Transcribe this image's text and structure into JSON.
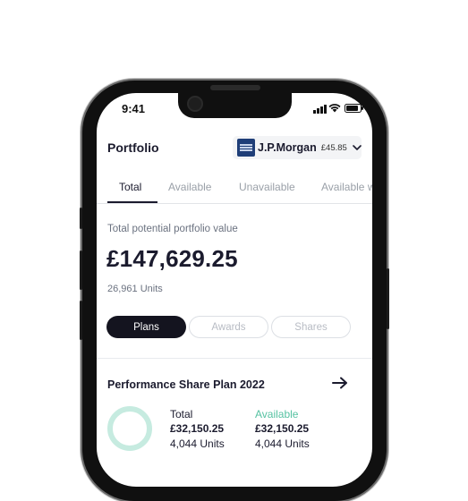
{
  "status_bar": {
    "time": "9:41"
  },
  "header": {
    "title": "Portfolio",
    "account": {
      "company": "J.P.Morgan",
      "price": "£45.85"
    }
  },
  "tabs": [
    {
      "label": "Total",
      "active": true
    },
    {
      "label": "Available",
      "active": false
    },
    {
      "label": "Unavailable",
      "active": false
    },
    {
      "label": "Available w",
      "active": false
    }
  ],
  "summary": {
    "label": "Total potential portfolio value",
    "value": "£147,629.25",
    "units": "26,961 Units"
  },
  "filters": [
    {
      "label": "Plans",
      "active": true
    },
    {
      "label": "Awards",
      "active": false
    },
    {
      "label": "Shares",
      "active": false
    }
  ],
  "plan": {
    "title": "Performance Share Plan 2022",
    "total": {
      "label": "Total",
      "amount": "£32,150.25",
      "units": "4,044 Units"
    },
    "available": {
      "label": "Available",
      "amount": "£32,150.25",
      "units": "4,044 Units"
    }
  },
  "colors": {
    "primary": "#1b1b2e",
    "accent_green": "#56c2a2",
    "donut": "#c6ebe0",
    "logo_blue": "#1f3e78"
  },
  "icons": [
    "cellular-signal-icon",
    "wifi-icon",
    "battery-icon",
    "chevron-down-icon",
    "arrow-right-icon",
    "jp-morgan-logo-icon"
  ]
}
